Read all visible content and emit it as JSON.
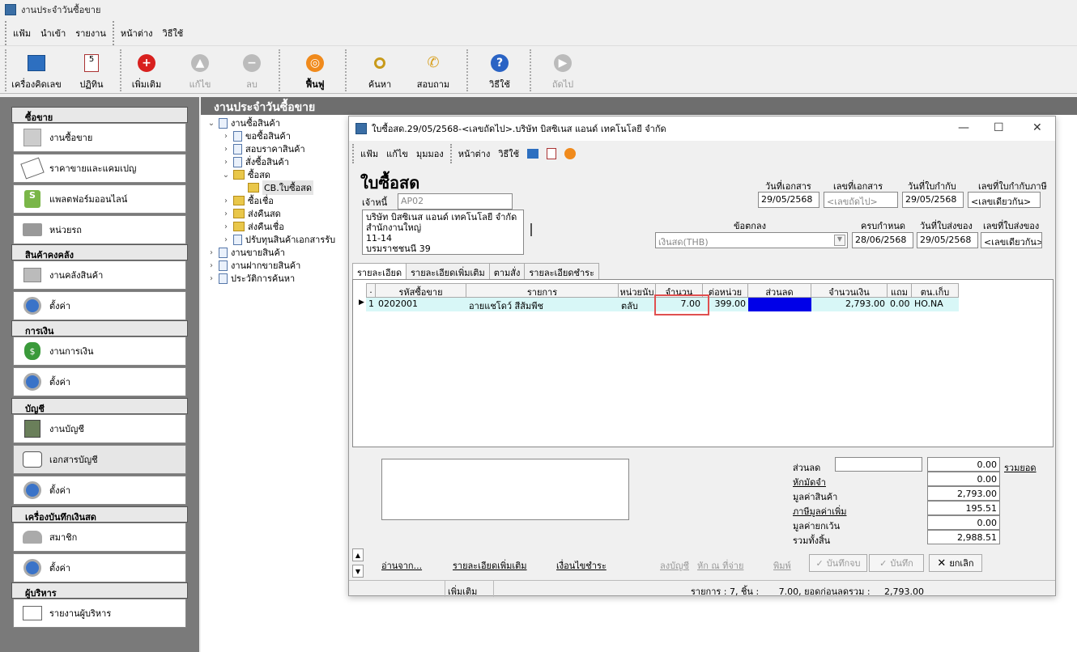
{
  "app": {
    "title": "งานประจำวันซื้อขาย"
  },
  "menu": {
    "group1": [
      "แฟ้ม",
      "นำเข้า",
      "รายงาน"
    ],
    "group2": [
      "หน้าต่าง",
      "วิธีใช้"
    ]
  },
  "toolbar": {
    "calculator": "เครื่องคิดเลข",
    "calendar": "ปฏิทิน",
    "add": "เพิ่มเติม",
    "edit": "แก้ไข",
    "delete": "ลบ",
    "restore": "ฟื้นฟู",
    "search": "ค้นหา",
    "inquire": "สอบถาม",
    "help": "วิธีใช้",
    "next": "ถัดไป"
  },
  "sidebar": {
    "sections": [
      {
        "title": "ซื้อขาย",
        "items": [
          "งานซื้อขาย",
          "ราคาขายและแคมเปญ",
          "แพลตฟอร์มออนไลน์",
          "หน่วยรถ"
        ]
      },
      {
        "title": "สินค้าคงคลัง",
        "items": [
          "งานคลังสินค้า",
          "ตั้งค่า"
        ]
      },
      {
        "title": "การเงิน",
        "items": [
          "งานการเงิน",
          "ตั้งค่า"
        ]
      },
      {
        "title": "บัญชี",
        "items": [
          "งานบัญชี",
          "เอกสารบัญชี",
          "ตั้งค่า"
        ]
      },
      {
        "title": "เครื่องบันทึกเงินสด",
        "items": [
          "สมาชิก",
          "ตั้งค่า"
        ]
      },
      {
        "title": "ผู้บริหาร",
        "items": [
          "รายงานผู้บริหาร"
        ]
      }
    ]
  },
  "main": {
    "header": "งานประจำวันซื้อขาย"
  },
  "tree": [
    {
      "label": "งานซื้อสินค้า"
    },
    {
      "label": "ขอซื้อสินค้า"
    },
    {
      "label": "สอบราคาสินค้า"
    },
    {
      "label": "สั่งซื้อสินค้า"
    },
    {
      "label": "ซื้อสด"
    },
    {
      "label": "CB.ใบซื้อสด"
    },
    {
      "label": "ซื้อเชื่อ"
    },
    {
      "label": "ส่งคืนสด"
    },
    {
      "label": "ส่งคืนเชื่อ"
    },
    {
      "label": "ปรับทุนสินค้าเอกสารรับ"
    },
    {
      "label": "งานขายสินค้า"
    },
    {
      "label": "งานฝากขายสินค้า"
    },
    {
      "label": "ประวัติการค้นหา"
    }
  ],
  "doc": {
    "window_title": "ใบซื้อสด.29/05/2568-<เลขถัดไป>.บริษัท บิสซิเนส  แอนด์ เทคโนโลยี จำกัด",
    "menu1": [
      "แฟ้ม",
      "แก้ไข",
      "มุมมอง"
    ],
    "menu2": [
      "หน้าต่าง",
      "วิธีใช้"
    ],
    "heading": "ใบซื้อสด",
    "creditor_label": "เจ้าหนี้",
    "creditor_code": "AP02",
    "address": [
      "บริษัท บิสซิเนส  แอนด์ เทคโนโลยี จำกัด",
      "สำนักงานใหญ่",
      "11-14",
      "บรมราชชนนี 39"
    ],
    "doc_date_label": "วันที่เอกสาร",
    "doc_date": "29/05/2568",
    "doc_no_label": "เลขที่เอกสาร",
    "doc_no": "<เลขถัดไป>",
    "tax_date_label": "วันที่ใบกำกับ",
    "tax_date": "29/05/2568",
    "tax_no_label": "เลขที่ใบกำกับภาษี",
    "tax_no": "<เลขเดียวกัน>",
    "terms_label": "ข้อตกลง",
    "terms": "เงินสด(THB)",
    "due_label": "ครบกำหนด",
    "due": "28/06/2568",
    "deliver_date_label": "วันที่ใบส่งของ",
    "deliver_date": "29/05/2568",
    "deliver_no_label": "เลขที่ใบส่งของ",
    "deliver_no": "<เลขเดียวกัน>",
    "tabs": [
      "รายละเอียด",
      "รายละเอียดเพิ่มเติม",
      "ตามสั่ง",
      "รายละเอียดชำระ"
    ],
    "columns": [
      ".",
      "รหัสซื้อขาย",
      "รายการ",
      "หน่วยนับ",
      "จำนวน",
      "ต่อหน่วย",
      "ส่วนลด",
      "จำนวนเงิน",
      "แถม",
      "ตน.เก็บ"
    ],
    "rows": [
      {
        "no": "1",
        "code": "0202001",
        "name": "อายแชโดว์ สีส้มพีช",
        "unit": "ตลับ",
        "qty": "7.00",
        "price": "399.00",
        "discount": "",
        "amount": "2,793.00",
        "free": "0.00",
        "loc": "HO.NA"
      }
    ],
    "summary": {
      "discount_label": "ส่วนลด",
      "discount": "0.00",
      "total_link": "รวมยอด",
      "deposit_label": "หักมัดจำ",
      "deposit": "0.00",
      "goods_label": "มูลค่าสินค้า",
      "goods": "2,793.00",
      "vat_label": "ภาษีมูลค่าเพิ่ม",
      "vat": "195.51",
      "exempt_label": "มูลค่ายกเว้น",
      "exempt": "0.00",
      "grand_label": "รวมทั้งสิ้น",
      "grand": "2,988.51"
    },
    "bottom": {
      "read_from": "อ่านจาก...",
      "more_detail": "รายละเอียดเพิ่มเติม",
      "payment_cond": "เงื่อนไขชำระ",
      "post": "ลงบัญชี",
      "withholding": "หัก ณ ที่จ่าย",
      "print": "พิมพ์",
      "save_close": "บันทึกจบ",
      "save": "บันทึก",
      "cancel": "ยกเลิก"
    },
    "status": {
      "mode": "เพิ่มเติม",
      "summary_text": "รายการ : 7, ชิ้น :       7.00, ยอดก่อนลดรวม :     2,793.00"
    }
  }
}
